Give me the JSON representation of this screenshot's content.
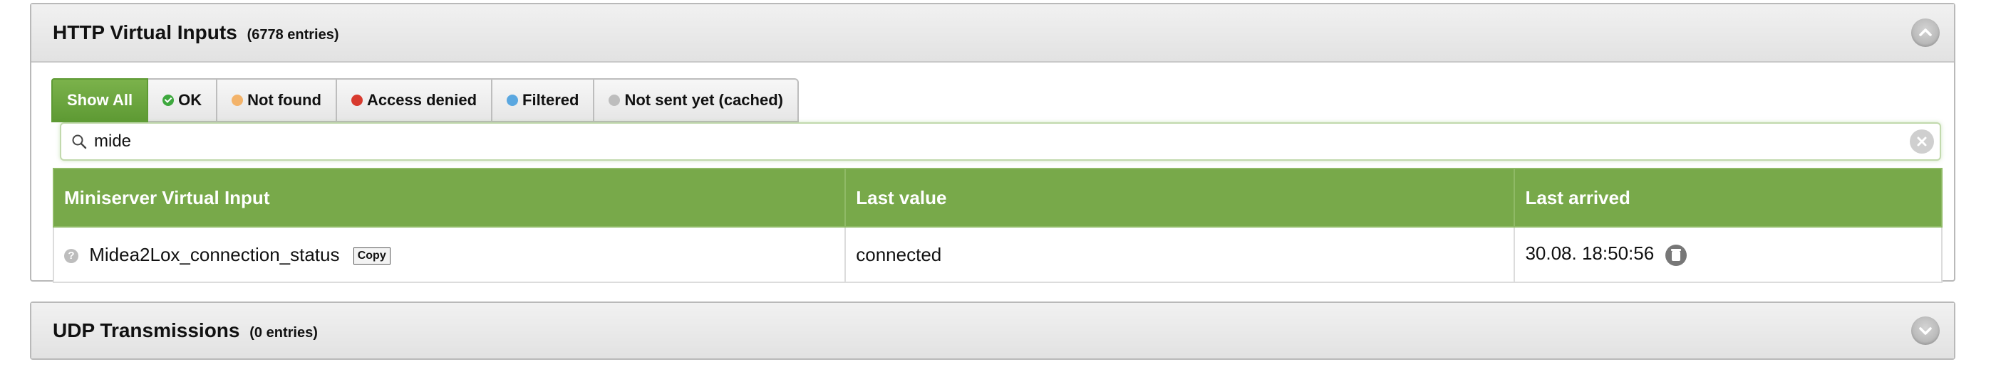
{
  "http_panel": {
    "title": "HTTP Virtual Inputs",
    "count": "(6778 entries)",
    "toggle_icon": "chevron-up-icon"
  },
  "filters": [
    {
      "label": "Show All",
      "icon": null,
      "active": true
    },
    {
      "label": "OK",
      "icon": "ok-icon"
    },
    {
      "label": "Not found",
      "icon": "not-found-icon"
    },
    {
      "label": "Access denied",
      "icon": "access-denied-icon"
    },
    {
      "label": "Filtered",
      "icon": "filtered-icon"
    },
    {
      "label": "Not sent yet (cached)",
      "icon": "not-sent-icon"
    }
  ],
  "search": {
    "value": "mide",
    "placeholder": ""
  },
  "table": {
    "headers": [
      "Miniserver Virtual Input",
      "Last value",
      "Last arrived"
    ],
    "rows": [
      {
        "name": "Midea2Lox_connection_status",
        "copy_label": "Copy",
        "value": "connected",
        "arrived": "30.08. 18:50:56"
      }
    ]
  },
  "udp_panel": {
    "title": "UDP Transmissions",
    "count": "(0 entries)",
    "toggle_icon": "chevron-down-icon"
  },
  "colors": {
    "accent_green": "#78a94a",
    "active_tab": "#5e9a34",
    "header_bg": "#e8e8e8"
  }
}
